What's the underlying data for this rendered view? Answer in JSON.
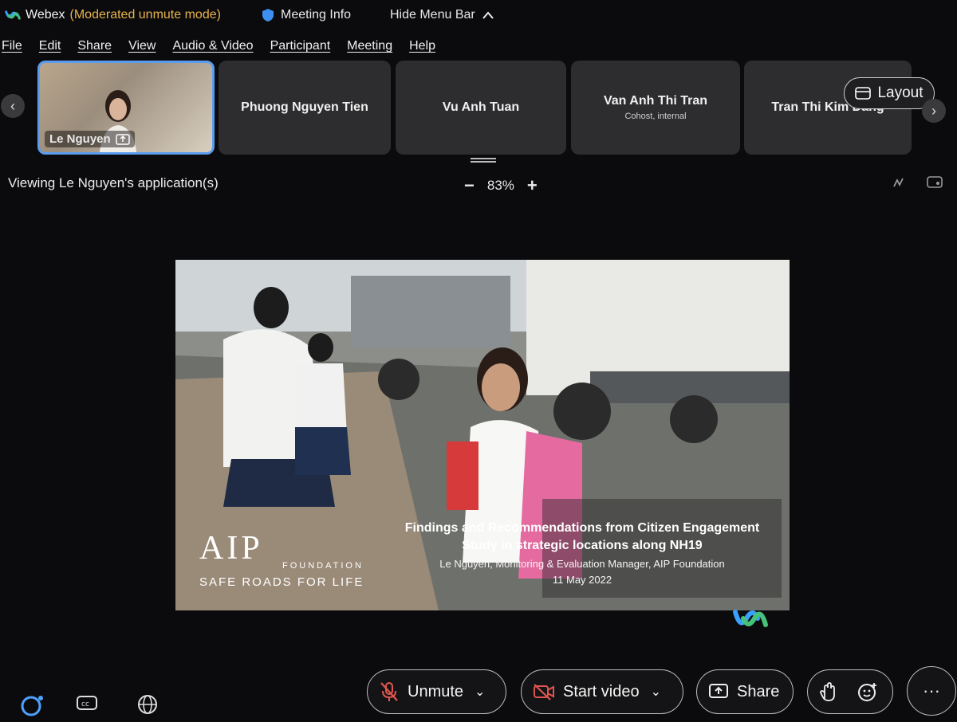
{
  "titlebar": {
    "app_name": "Webex",
    "mode": "(Moderated unmute mode)",
    "meeting_info": "Meeting Info",
    "hide_menu": "Hide Menu Bar"
  },
  "menu": [
    "File",
    "Edit",
    "Share",
    "View",
    "Audio & Video",
    "Participant",
    "Meeting",
    "Help"
  ],
  "participants": [
    {
      "name": "Le Nguyen",
      "sub": ""
    },
    {
      "name": "Phuong Nguyen Tien",
      "sub": ""
    },
    {
      "name": "Vu Anh Tuan",
      "sub": ""
    },
    {
      "name": "Van Anh Thi Tran",
      "sub": "Cohost, internal"
    },
    {
      "name": "Tran Thi Kim Dang",
      "sub": ""
    }
  ],
  "layout_label": "Layout",
  "viewing_text": "Viewing Le Nguyen's application(s)",
  "zoom": {
    "minus": "−",
    "value": "83%",
    "plus": "+"
  },
  "slide": {
    "title_line1": "Findings and Recommendations from Citizen Engagement",
    "title_line2": "Study in strategic locations along NH19",
    "author": "Le Nguyen, Monitoring & Evaluation Manager, AIP Foundation",
    "date": "11 May 2022",
    "logo_text": "AIP",
    "logo_foundation": "FOUNDATION",
    "logo_tagline": "SAFE ROADS FOR LIFE"
  },
  "controls": {
    "unmute": "Unmute",
    "start_video": "Start video",
    "share": "Share"
  },
  "colors": {
    "accent_blue": "#5a9df0",
    "mode_orange": "#e7b34a",
    "mute_red": "#e0564f"
  }
}
